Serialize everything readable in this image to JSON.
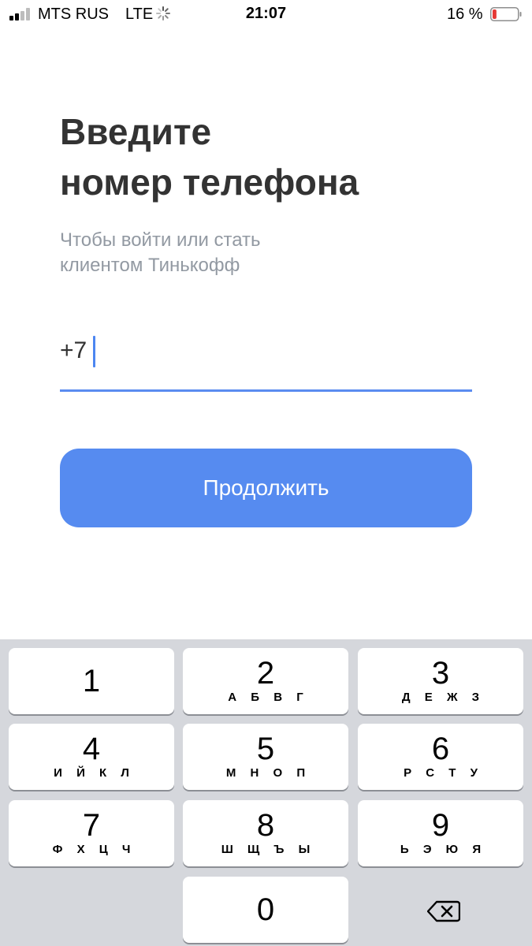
{
  "status_bar": {
    "carrier": "MTS RUS",
    "network": "LTE",
    "time": "21:07",
    "battery_percent": "16 %",
    "battery_level": 0.16,
    "battery_color": "#e53935"
  },
  "login": {
    "title_line1": "Введите",
    "title_line2": "номер телефона",
    "subtitle_line1": "Чтобы войти или стать",
    "subtitle_line2": "клиентом Тинькофф",
    "phone_value": "+7",
    "continue_label": "Продолжить"
  },
  "colors": {
    "accent": "#568bf0",
    "underline": "#5b8cf0",
    "title": "#333333",
    "subtitle": "#9299a2",
    "keypad_bg": "#d5d7dc"
  },
  "keypad": {
    "keys": [
      {
        "digit": "1",
        "letters": ""
      },
      {
        "digit": "2",
        "letters": "А Б В Г"
      },
      {
        "digit": "3",
        "letters": "Д Е Ж З"
      },
      {
        "digit": "4",
        "letters": "И Й К Л"
      },
      {
        "digit": "5",
        "letters": "М Н О П"
      },
      {
        "digit": "6",
        "letters": "Р С Т У"
      },
      {
        "digit": "7",
        "letters": "Ф Х Ц Ч"
      },
      {
        "digit": "8",
        "letters": "Ш Щ Ъ Ы"
      },
      {
        "digit": "9",
        "letters": "Ь Э Ю Я"
      },
      {
        "digit": "0",
        "letters": ""
      }
    ],
    "backspace_icon": "backspace-icon"
  }
}
